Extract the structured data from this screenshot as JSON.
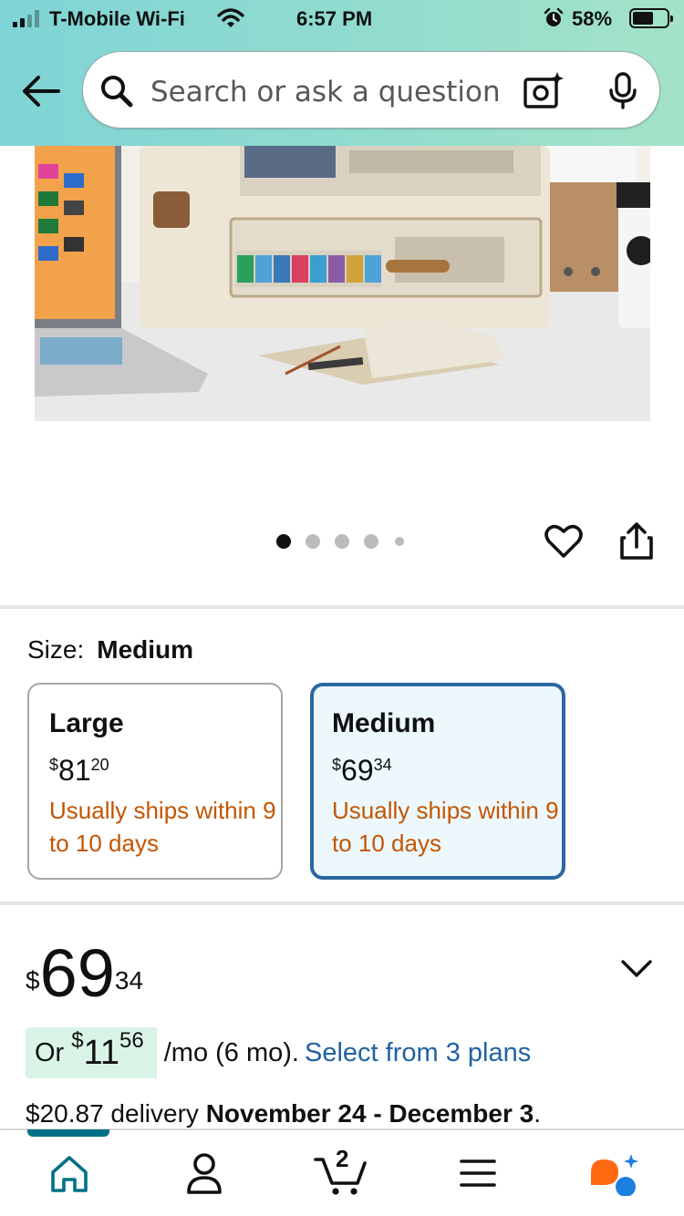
{
  "status_bar": {
    "carrier": "T-Mobile Wi-Fi",
    "time": "6:57 PM",
    "battery_percent": "58%"
  },
  "search": {
    "placeholder": "Search or ask a question"
  },
  "icons": {
    "back": "back-arrow-icon",
    "search": "search-icon",
    "camera": "camera-sparkle-icon",
    "mic": "microphone-icon",
    "heart": "heart-icon",
    "share": "share-icon",
    "chevron": "chevron-down-icon",
    "home": "home-icon",
    "account": "account-icon",
    "cart": "cart-icon",
    "menu": "menu-icon",
    "rufus": "rufus-assistant-icon"
  },
  "gallery": {
    "image_count": 5,
    "current_index": 0
  },
  "size": {
    "label": "Size:",
    "selected": "Medium",
    "options": [
      {
        "name": "Large",
        "currency": "$",
        "dollars": "81",
        "cents": "20",
        "shipping": "Usually ships within 9 to 10 days",
        "selected": false
      },
      {
        "name": "Medium",
        "currency": "$",
        "dollars": "69",
        "cents": "34",
        "shipping": "Usually ships within 9 to 10 days",
        "selected": true
      }
    ]
  },
  "price": {
    "currency": "$",
    "dollars": "69",
    "cents": "34"
  },
  "installment": {
    "prefix": "Or",
    "currency": "$",
    "dollars": "11",
    "cents": "56",
    "term": "/mo (6 mo).",
    "link": "Select from 3 plans"
  },
  "delivery": {
    "fee": "$20.87",
    "text": "delivery",
    "dates": "November 24 - December 3",
    "suffix": "."
  },
  "bottom_nav": {
    "cart_count": "2",
    "active": "home"
  },
  "colors": {
    "header_start": "#7fd4d6",
    "header_end": "#a4e3c8",
    "shipping_text": "#c45500",
    "selected_border": "#2b66a2",
    "selected_bg": "#edf8fd",
    "link": "#2162a1",
    "installment_bg": "#d9f4e7",
    "nav_active": "#007185"
  }
}
